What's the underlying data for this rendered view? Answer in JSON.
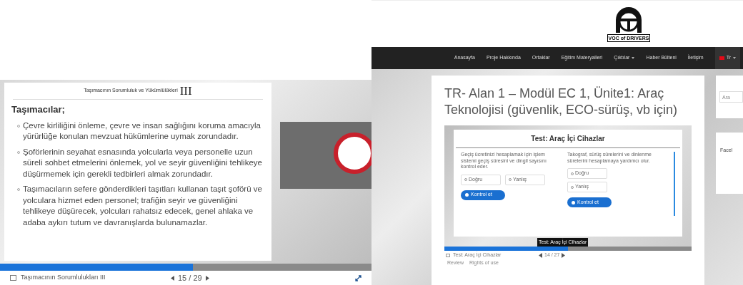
{
  "left_player": {
    "slide_header": "Taşımacının Sorumluluk ve Yükümlülükleri",
    "header_numeral": "III",
    "heading": "Taşımacılar;",
    "bullets": [
      "Çevre kirliliğini önleme, çevre ve insan sağlığını koruma amacıyla yürürlüğe konulan mevzuat hükümlerine uymak zorundadır.",
      "Şoförlerinin seyahat esnasında yolcularla veya personelle uzun süreli sohbet etmelerini önlemek, yol ve seyir güvenliğini tehlikeye düşürmemek için gerekli tedbirleri almak zorundadır.",
      "Taşımacıların sefere gönderdikleri taşıtları kullanan taşıt şoförü ve yolculara hizmet eden personel; trafiğin seyir ve güvenliğini tehlikeye düşürecek, yolcuları rahatsız edecek, genel ahlaka ve adaba aykırı tutum ve davranışlarda bulunamazlar."
    ],
    "progress": {
      "level": 0.52
    },
    "footer_title": "Taşımacının Sorumlulukları III",
    "page": "15 / 29"
  },
  "site": {
    "logo_text": "VOC of DRIVERS",
    "nav": [
      {
        "label": "Anasayfa",
        "dropdown": false
      },
      {
        "label": "Proje Hakkında",
        "dropdown": false
      },
      {
        "label": "Ortaklar",
        "dropdown": false
      },
      {
        "label": "Eğitim Materyalleri",
        "dropdown": false
      },
      {
        "label": "Çıktılar",
        "dropdown": true
      },
      {
        "label": "Haber Bülteni",
        "dropdown": false
      },
      {
        "label": "İletişim",
        "dropdown": false
      }
    ],
    "language": "Tr",
    "page_title": "TR- Alan 1 – Modül EC 1, Ünite1: Araç Teknolojisi (güvenlik, ECO-sürüş, vb için)",
    "quiz": {
      "title": "Test: Araç İçi Cihazlar",
      "questions": [
        {
          "statement": "Geçiş ücretinizi hesaplamak için işlem sistemi geçiş süresini ve dingil sayısını kontrol eder.",
          "kind": "row",
          "options": [
            "Doğru",
            "Yanlış"
          ],
          "button": "Kontrol et"
        },
        {
          "statement": "Takograf, sürüş sürelerini ve dinlenme sürelerini hesaplamaya yardımcı olur.",
          "kind": "column",
          "options": [
            "Doğru",
            "Yanlış"
          ],
          "button": "Kontrol et"
        }
      ]
    },
    "tooltip": "Test: Araç İçi Cihazlar",
    "progress": {
      "level": 0.5
    },
    "footer_title": "Test: Araç İçi Cihazlar",
    "page": "14 / 27",
    "links": [
      "Review",
      "Rights of use"
    ],
    "sidebar": {
      "search_placeholder": "Ara",
      "widget_title": "Facel"
    }
  }
}
